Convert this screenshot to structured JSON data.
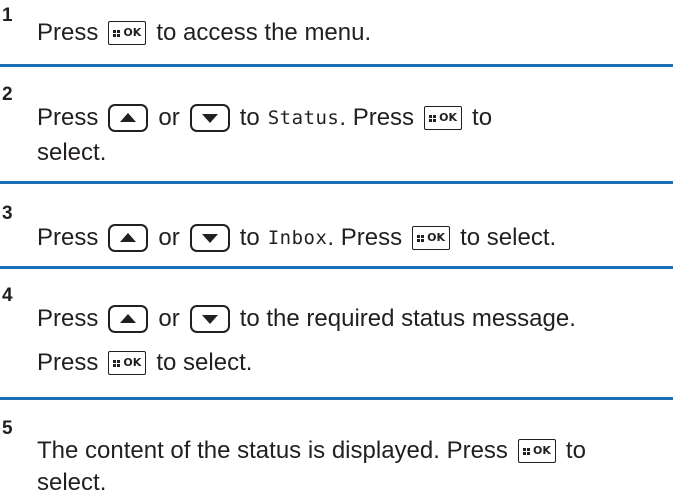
{
  "steps": [
    {
      "number": "1",
      "lines": [
        [
          "Press",
          "{ok}",
          "to access the menu."
        ]
      ]
    },
    {
      "number": "2",
      "lines": [
        [
          "Press",
          "{up}",
          "or",
          "{down}",
          "to",
          "Status",
          ". Press",
          "{ok}",
          "to"
        ],
        [
          "select."
        ]
      ]
    },
    {
      "number": "3",
      "lines": [
        [
          "Press",
          "{up}",
          "or",
          "{down}",
          "to",
          "Inbox",
          ". Press",
          "{ok}",
          "to select."
        ]
      ]
    },
    {
      "number": "4",
      "lines": [
        [
          "Press",
          "{up}",
          "or",
          "{down}",
          "to the required status message."
        ],
        [
          "Press",
          "{ok}",
          "to select."
        ]
      ]
    },
    {
      "number": "5",
      "lines": [
        [
          "The content of the status is displayed. Press",
          "{ok}",
          "to"
        ],
        [
          "select."
        ]
      ]
    }
  ],
  "text": {
    "s1_press": "Press",
    "s1_rest": "to access the menu.",
    "s2_press": "Press",
    "s2_or": "or",
    "s2_to": "to",
    "s2_menu": "Status",
    "s2_press2": ". Press",
    "s2_to2": "to",
    "s2_select": "select.",
    "s3_press": "Press",
    "s3_or": "or",
    "s3_to": "to",
    "s3_menu": "Inbox",
    "s3_press2": ". Press",
    "s3_rest": "to select.",
    "s4_press": "Press",
    "s4_or": "or",
    "s4_rest": "to the required status message.",
    "s4_press2": "Press",
    "s4_rest2": "to select.",
    "s5_text": "The content of the status is displayed. Press",
    "s5_to": "to",
    "s5_select": "select."
  },
  "icons": {
    "ok_label": "OK",
    "ok_key": "menu-ok-button-icon",
    "up_key": "up-arrow-button-icon",
    "down_key": "down-arrow-button-icon"
  },
  "colors": {
    "divider": "#1a6fb5",
    "text": "#231f20"
  }
}
